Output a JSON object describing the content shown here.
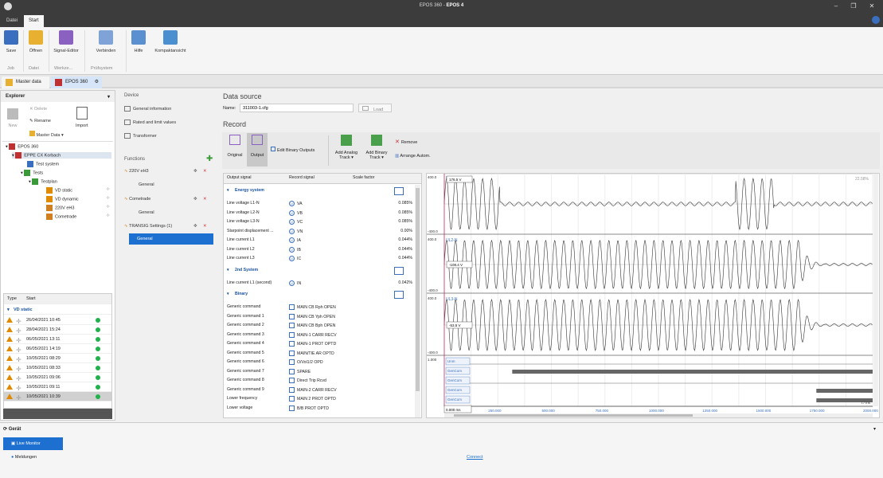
{
  "window": {
    "title_app": "EPOS 360",
    "title_sep": " - ",
    "title_prod": "EPOS 4"
  },
  "ribbon_tabs": [
    "Datei",
    "Start"
  ],
  "ribbon": {
    "buttons": [
      {
        "label": "Save",
        "color": "#3a6fc0"
      },
      {
        "label": "Öffnen",
        "color": "#e8b030"
      },
      {
        "label": "Signal-Editor",
        "color": "#8a60c0"
      },
      {
        "label": "Verbinden",
        "color": "#7fa3d6"
      },
      {
        "label": "Hilfe",
        "color": "#5a8fd0"
      },
      {
        "label": "Kompaktansicht",
        "color": "#4a90d0"
      }
    ],
    "groups": [
      "Job",
      "Datei",
      "Werkze...",
      "Prüfsystem"
    ]
  },
  "doc_tabs": [
    {
      "label": "Master data"
    },
    {
      "label": "EPOS 360"
    }
  ],
  "explorer": {
    "title": "Explorer",
    "pin": "▾",
    "tools": {
      "new": "New",
      "delete": "Delete",
      "rename": "Rename",
      "master_data": "Master Data",
      "import": "Import"
    },
    "tree": [
      {
        "label": "EPOS 360"
      },
      {
        "label": "EPPE CX Korbach"
      },
      {
        "label": "Test system"
      },
      {
        "label": "Tests"
      },
      {
        "label": "Testplan"
      },
      {
        "label": "VD static"
      },
      {
        "label": "VD dynamic"
      },
      {
        "label": "220V eH3"
      },
      {
        "label": "Cometrade"
      }
    ],
    "list_headers": [
      "Type",
      "Start"
    ],
    "list_group": "VD static",
    "list_rows": [
      "26/04/2021 10:45",
      "28/04/2021 15:24",
      "06/05/2021 13:11",
      "06/05/2021 14:19",
      "10/05/2021 08:29",
      "10/05/2021 08:33",
      "10/05/2021 09:06",
      "10/05/2021 09:11",
      "10/05/2021 10:39"
    ]
  },
  "device": {
    "title": "Device",
    "items": [
      "General information",
      "Rated and limit values",
      "Transformer"
    ],
    "functions_title": "Functions",
    "functions": [
      {
        "label": "220V eH3",
        "sub": "General"
      },
      {
        "label": "Cometrade",
        "sub": "General"
      },
      {
        "label": "TRANSIG Settings (1)",
        "sub": "General"
      }
    ]
  },
  "datasource": {
    "title": "Data source",
    "name_label": "Name:",
    "name_value": "311003-1.cfg",
    "load_label": "Load"
  },
  "record": {
    "title": "Record",
    "buttons": [
      "Original",
      "Output",
      "Edit Binary Outputs",
      "Add Analog Track ▾",
      "Add Binary Track ▾",
      "Remove",
      "Arrange Autom."
    ],
    "headers": [
      "Output signal",
      "Record signal",
      "Scale factor"
    ],
    "sections": [
      {
        "name": "Energy system",
        "rows": [
          [
            "Line voltage L1-N",
            "VA",
            "0.085%"
          ],
          [
            "Line voltage L2-N",
            "VB",
            "0.085%"
          ],
          [
            "Line voltage L3-N",
            "VC",
            "0.085%"
          ],
          [
            "Starpoint displacement ...",
            "VN",
            "0.00%"
          ],
          [
            "Line current L1",
            "IA",
            "0.044%"
          ],
          [
            "Line current L2",
            "IB",
            "0.044%"
          ],
          [
            "Line current L3",
            "IC",
            "0.044%"
          ]
        ]
      },
      {
        "name": "2nd System",
        "rows": [
          [
            "Line current L1 (second)",
            "IN",
            "0.042%"
          ]
        ]
      },
      {
        "name": "Binary",
        "rows": [
          [
            "Generic command",
            "MAIN CB Rph OPEN",
            ""
          ],
          [
            "Generic command 1",
            "MAIN CB Yph OPEN",
            ""
          ],
          [
            "Generic command 2",
            "MAIN CB Bph OPEN",
            ""
          ],
          [
            "Generic command 3",
            "MAIN-1 CARR RECV",
            ""
          ],
          [
            "Generic command 4",
            "MAIN-1 PROT OPTD",
            ""
          ],
          [
            "Generic command 5",
            "MAIN/TIE AR OPTD",
            ""
          ],
          [
            "Generic command 6",
            "O/Vol1/2 OPD",
            ""
          ],
          [
            "Generic command 7",
            "SPARE",
            ""
          ],
          [
            "Generic command 8",
            "Direct Trip Rcvd",
            ""
          ],
          [
            "Generic command 9",
            "MAIN-2 CARR RECV",
            ""
          ],
          [
            "Lower frequency",
            "MAIN 2 PROT OPTD",
            ""
          ],
          [
            "Lower voltage",
            "B/B PROT OPTD",
            ""
          ]
        ]
      }
    ]
  },
  "scope": {
    "zoom": "22.58%",
    "tracks": [
      {
        "label": "UL1-N",
        "top": "400.0",
        "bottom": "-400.0",
        "value": "176.5 V"
      },
      {
        "label": "UL2-N",
        "top": "400.0",
        "bottom": "-400.0",
        "value": "-108.4 V"
      },
      {
        "label": "UL3-N",
        "top": "400.0",
        "bottom": "-400.0",
        "value": "-53.5 V"
      }
    ],
    "binary": {
      "top": "1.000",
      "labels": [
        "Unm",
        "GenCom",
        "GenCom",
        "GenCom",
        "GenCom"
      ]
    },
    "xticks": [
      "250.000",
      "500.000",
      "750.000",
      "1000.000",
      "1250.000",
      "1500.000",
      "1750.000",
      "2000.000"
    ],
    "cursor": "0.000 ms",
    "xunit": "t / ms"
  },
  "status": {
    "panel_title": "Gerät",
    "live_monitor": "Live Monitor",
    "messages": "Meldungen",
    "connect": "Connect"
  }
}
